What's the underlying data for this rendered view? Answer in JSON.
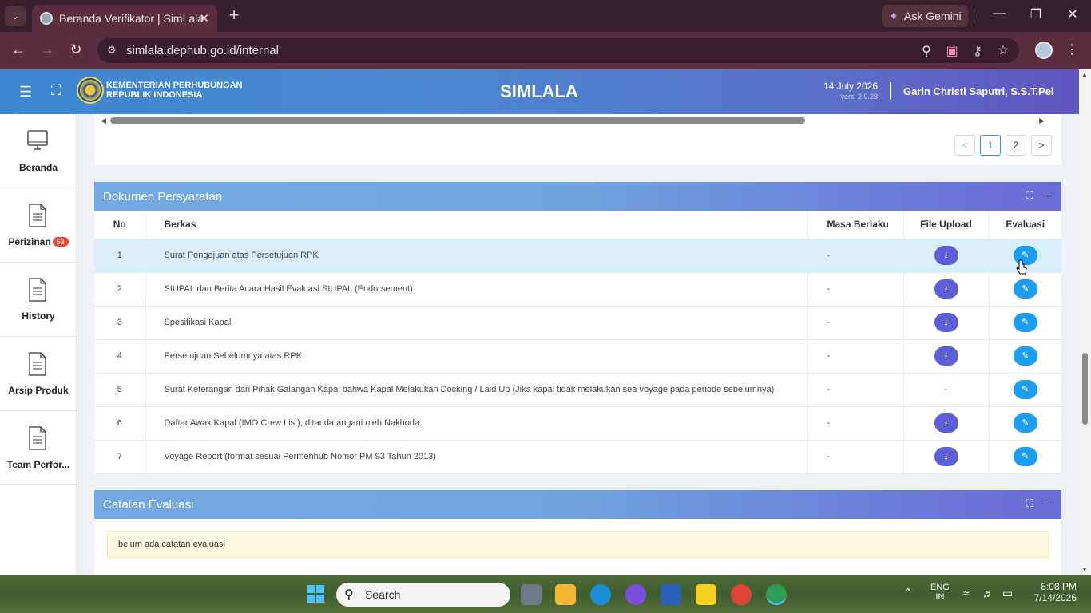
{
  "browser": {
    "tab_title": "Beranda Verifikator | SimLala",
    "url": "simlala.dephub.go.id/internal",
    "gemini_label": "Ask Gemini"
  },
  "header": {
    "org_line1": "KEMENTERIAN PERHUBUNGAN",
    "org_line2": "REPUBLIK INDONESIA",
    "app_name": "SIMLALA",
    "date": "14 July 2026",
    "version": "versi 2.0.28",
    "user": "Garin Christi Saputri, S.S.T.Pel"
  },
  "sidebar": {
    "items": [
      {
        "label": "Beranda",
        "icon": "monitor-icon"
      },
      {
        "label": "Perizinan",
        "icon": "document-icon",
        "badge": "53"
      },
      {
        "label": "History",
        "icon": "document-icon"
      },
      {
        "label": "Arsip Produk",
        "icon": "document-icon"
      },
      {
        "label": "Team Perfor...",
        "icon": "document-icon"
      }
    ]
  },
  "pagination": {
    "prev": "<",
    "pages": [
      "1",
      "2"
    ],
    "next": ">",
    "current": "1"
  },
  "dokumen": {
    "title": "Dokumen Persyaratan",
    "columns": {
      "no": "No",
      "berkas": "Berkas",
      "masa": "Masa Berlaku",
      "file": "File Upload",
      "eval": "Evaluasi"
    },
    "rows": [
      {
        "no": "1",
        "berkas": "Surat Pengajuan atas Persetujuan RPK",
        "masa": "-",
        "file": "download"
      },
      {
        "no": "2",
        "berkas": "SIUPAL dan Berita Acara Hasil Evaluasi SIUPAL (Endorsement)",
        "masa": "-",
        "file": "download"
      },
      {
        "no": "3",
        "berkas": "Spesifikasi Kapal",
        "masa": "-",
        "file": "download"
      },
      {
        "no": "4",
        "berkas": "Persetujuan Sebelumnya atas RPK",
        "masa": "-",
        "file": "download"
      },
      {
        "no": "5",
        "berkas": "Surat Keterangan dari Pihak Galangan Kapal bahwa Kapal Melakukan Docking / Laid Up (Jika kapal tidak melakukan sea voyage pada periode sebelumnya)",
        "masa": "-",
        "file": "-"
      },
      {
        "no": "6",
        "berkas": "Daftar Awak Kapal (IMO Crew List), ditandatangani oleh Nakhoda",
        "masa": "-",
        "file": "download"
      },
      {
        "no": "7",
        "berkas": "Voyage Report (format sesuai Permenhub Nomor PM 93 Tahun 2013)",
        "masa": "-",
        "file": "download"
      }
    ]
  },
  "catatan": {
    "title": "Catatan Evaluasi",
    "note": "belum ada catatan evaluasi"
  },
  "taskbar": {
    "search_placeholder": "Search",
    "lang_line1": "ENG",
    "lang_line2": "IN",
    "time": "8:08 PM",
    "date": "7/14/2026"
  }
}
